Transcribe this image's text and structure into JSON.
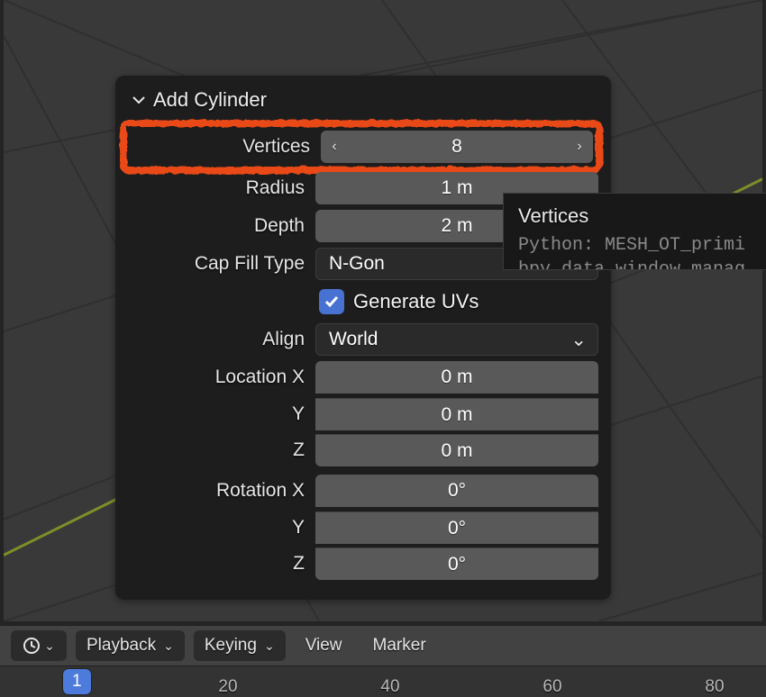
{
  "panel": {
    "title": "Add Cylinder",
    "vertices": {
      "label": "Vertices",
      "value": "8"
    },
    "radius": {
      "label": "Radius",
      "value": "1 m"
    },
    "depth": {
      "label": "Depth",
      "value": "2 m"
    },
    "cap_fill": {
      "label": "Cap Fill Type",
      "value": "N-Gon"
    },
    "generate_uvs": {
      "label": "Generate UVs",
      "checked": true
    },
    "align": {
      "label": "Align",
      "value": "World"
    },
    "location": {
      "label": "Location X",
      "y_label": "Y",
      "z_label": "Z",
      "x": "0 m",
      "y": "0 m",
      "z": "0 m"
    },
    "rotation": {
      "label": "Rotation X",
      "y_label": "Y",
      "z_label": "Z",
      "x": "0°",
      "y": "0°",
      "z": "0°"
    }
  },
  "tooltip": {
    "title": "Vertices",
    "body": "Python: MESH_OT_primi\nbpy.data.window_manag"
  },
  "timeline": {
    "playback": "Playback",
    "keying": "Keying",
    "view": "View",
    "marker": "Marker",
    "ticks": [
      "20",
      "40",
      "60",
      "80"
    ],
    "current_frame": "1"
  }
}
